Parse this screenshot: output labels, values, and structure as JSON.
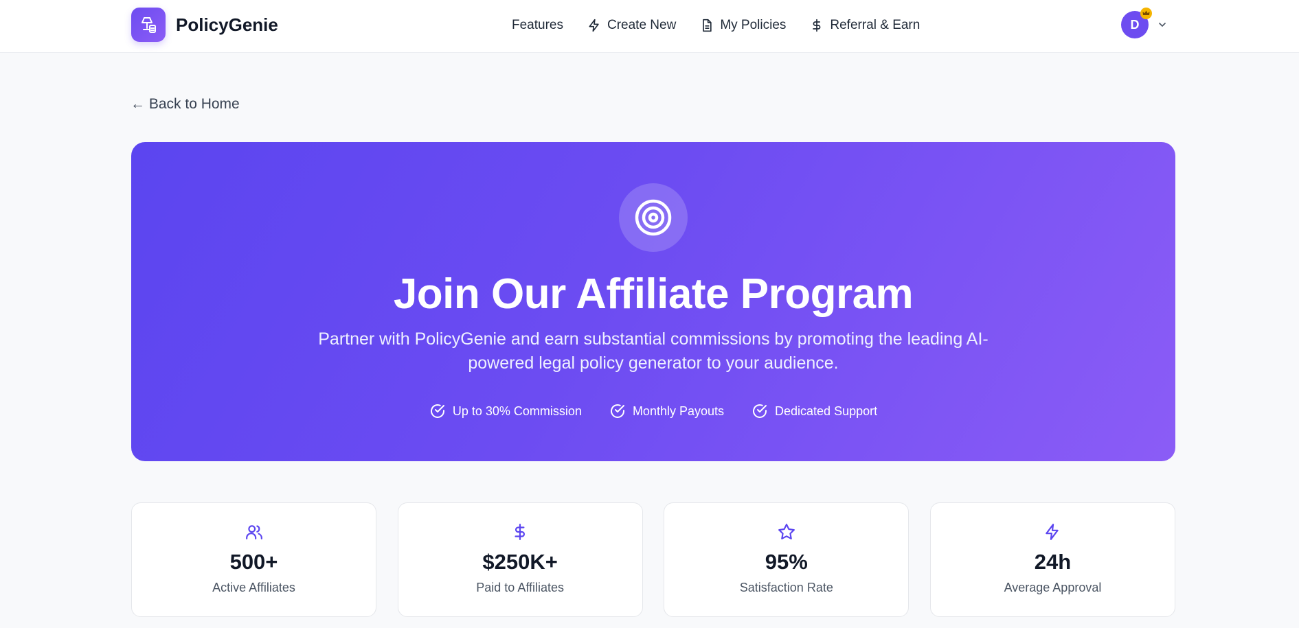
{
  "header": {
    "brand": "PolicyGenie",
    "nav": [
      {
        "label": "Features",
        "icon": "none"
      },
      {
        "label": "Create New",
        "icon": "lightning-icon"
      },
      {
        "label": "My Policies",
        "icon": "document-icon"
      },
      {
        "label": "Referral & Earn",
        "icon": "dollar-icon"
      }
    ],
    "avatar_initial": "D"
  },
  "back_link": "← Back to Home",
  "hero": {
    "title": "Join Our Affiliate Program",
    "subtitle": "Partner with PolicyGenie and earn substantial commissions by promoting the leading AI-powered legal policy generator to your audience.",
    "features": [
      "Up to 30% Commission",
      "Monthly Payouts",
      "Dedicated Support"
    ]
  },
  "stats": [
    {
      "value": "500+",
      "label": "Active Affiliates",
      "icon": "users-icon"
    },
    {
      "value": "$250K+",
      "label": "Paid to Affiliates",
      "icon": "dollar-icon"
    },
    {
      "value": "95%",
      "label": "Satisfaction Rate",
      "icon": "star-icon"
    },
    {
      "value": "24h",
      "label": "Average Approval",
      "icon": "lightning-icon"
    }
  ],
  "colors": {
    "accent": "#6d4cf0",
    "hero_start": "#5b45f0",
    "hero_end": "#8b5cf6",
    "crown": "#f5b400"
  }
}
